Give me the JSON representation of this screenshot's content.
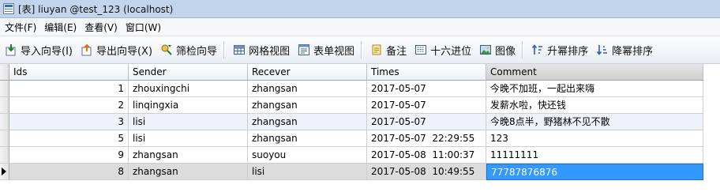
{
  "window": {
    "title": "[表] liuyan @test_123 (localhost)"
  },
  "menu": [
    "文件(F)",
    "编辑(E)",
    "查看(V)",
    "窗口(W)"
  ],
  "toolbar": {
    "import": "导入向导(I)",
    "export": "导出向导(X)",
    "filter": "筛检向导",
    "grid_view": "网格视图",
    "form_view": "表单视图",
    "memo": "备注",
    "hex": "十六进位",
    "image": "图像",
    "sort_asc": "升幂排序",
    "sort_desc": "降幂排序"
  },
  "table": {
    "columns": [
      "Ids",
      "Sender",
      "Recever",
      "Times",
      "Comment"
    ],
    "rows": [
      {
        "ids": "1",
        "sender": "zhouxingchi",
        "recever": "zhangsan",
        "times": "2017-05-07",
        "comment": "今晚不加班，一起出来嗨"
      },
      {
        "ids": "2",
        "sender": "linqingxia",
        "recever": "zhangsan",
        "times": "2017-05-07",
        "comment": "发薪水啦，快还钱"
      },
      {
        "ids": "3",
        "sender": "lisi",
        "recever": "zhangsan",
        "times": "2017-05-07",
        "comment": "今晚8点半，野猪林不见不散"
      },
      {
        "ids": "5",
        "sender": "lisi",
        "recever": "zhangsan",
        "times": "2017-05-07  22:29:55",
        "comment": "123"
      },
      {
        "ids": "9",
        "sender": "zhangsan",
        "recever": "suoyou",
        "times": "2017-05-08  11:00:37",
        "comment": "11111111"
      },
      {
        "ids": "8",
        "sender": "zhangsan",
        "recever": "lisi",
        "times": "2017-05-08  10:49:55",
        "comment": "77787876876"
      }
    ]
  },
  "colors": {
    "selection": "#3399ff",
    "titlebar": "#c3d5ec",
    "row_alt": "#eef3fb"
  }
}
